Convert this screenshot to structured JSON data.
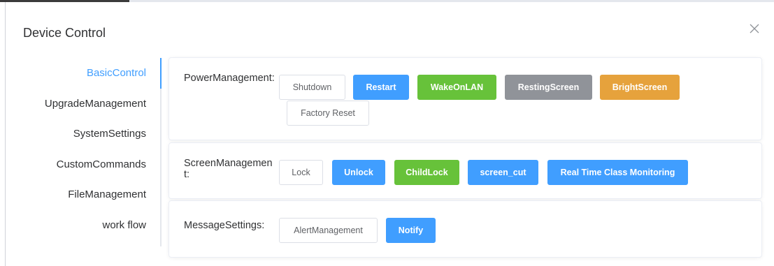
{
  "dialog": {
    "title": "Device Control",
    "close_icon": "close-icon"
  },
  "sidebar": {
    "items": [
      {
        "label": "BasicControl",
        "active": true
      },
      {
        "label": "UpgradeManagement",
        "active": false
      },
      {
        "label": "SystemSettings",
        "active": false
      },
      {
        "label": "CustomCommands",
        "active": false
      },
      {
        "label": "FileManagement",
        "active": false
      },
      {
        "label": "work flow",
        "active": false
      }
    ],
    "accent_color": "#409eff"
  },
  "power": {
    "label": "PowerManagement:",
    "buttons": {
      "shutdown": "Shutdown",
      "restart": "Restart",
      "wake_on_lan": "WakeOnLAN",
      "resting_screen": "RestingScreen",
      "bright_screen": "BrightScreen",
      "factory_reset": "Factory Reset"
    }
  },
  "screen": {
    "label": "ScreenManagement:",
    "buttons": {
      "lock": "Lock",
      "unlock": "Unlock",
      "child_lock": "ChildLock",
      "screen_cut": "screen_cut",
      "real_time_monitoring": "Real Time Class Monitoring"
    }
  },
  "message": {
    "label": "MessageSettings:",
    "buttons": {
      "alert_management": "AlertManagement",
      "notify": "Notify"
    }
  },
  "colors": {
    "primary": "#409eff",
    "success": "#67c23a",
    "info": "#909399",
    "warning": "#e6a23c"
  }
}
